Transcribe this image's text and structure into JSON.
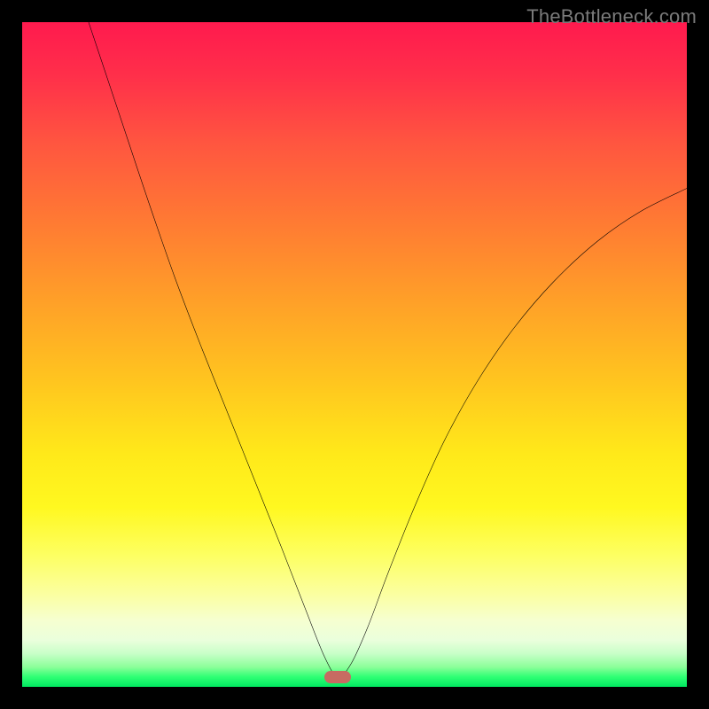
{
  "watermark": "TheBottleneck.com",
  "chart_data": {
    "type": "line",
    "title": "",
    "xlabel": "",
    "ylabel": "",
    "x_range": [
      0,
      100
    ],
    "y_range": [
      0,
      100
    ],
    "trough": {
      "x_percent": 47.5,
      "y_percent": 98.5
    },
    "curve_points_percent": [
      {
        "x": 10.0,
        "y": 0.0
      },
      {
        "x": 12.0,
        "y": 6.0
      },
      {
        "x": 15.0,
        "y": 15.0
      },
      {
        "x": 19.0,
        "y": 27.0
      },
      {
        "x": 23.0,
        "y": 38.5
      },
      {
        "x": 27.0,
        "y": 49.0
      },
      {
        "x": 31.0,
        "y": 59.0
      },
      {
        "x": 35.0,
        "y": 69.0
      },
      {
        "x": 39.0,
        "y": 79.0
      },
      {
        "x": 42.5,
        "y": 88.0
      },
      {
        "x": 45.5,
        "y": 95.5
      },
      {
        "x": 47.5,
        "y": 98.5
      },
      {
        "x": 49.5,
        "y": 96.5
      },
      {
        "x": 52.0,
        "y": 91.0
      },
      {
        "x": 55.0,
        "y": 83.0
      },
      {
        "x": 59.0,
        "y": 73.0
      },
      {
        "x": 63.5,
        "y": 63.0
      },
      {
        "x": 68.5,
        "y": 54.0
      },
      {
        "x": 74.0,
        "y": 46.0
      },
      {
        "x": 80.0,
        "y": 39.0
      },
      {
        "x": 86.5,
        "y": 33.0
      },
      {
        "x": 93.0,
        "y": 28.5
      },
      {
        "x": 100.0,
        "y": 25.0
      }
    ],
    "gradient_note": "vertical rainbow red→green indicates extra score; curve minimum marks optimal point",
    "legend": []
  },
  "colors": {
    "frame": "#000000",
    "curve": "#000000",
    "marker": "#c76b62",
    "watermark": "#7a7a7a"
  }
}
